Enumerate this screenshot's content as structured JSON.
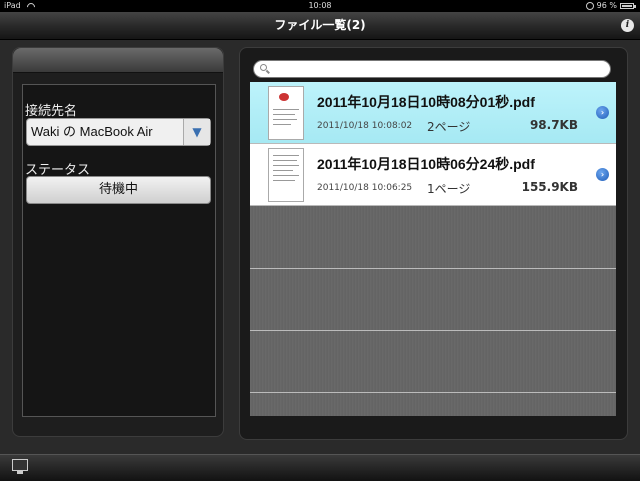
{
  "status_bar": {
    "device": "iPad",
    "time": "10:08",
    "battery": "96 %",
    "battery_level": 0.96
  },
  "nav": {
    "title": "ファイル一覧(2)",
    "info_symbol": "i"
  },
  "left": {
    "dest_label": "接続先名",
    "dest_value": "Waki の MacBook Air",
    "dest_arrow": "▼",
    "status_label": "ステータス",
    "status_value": "待機中"
  },
  "search": {
    "placeholder": ""
  },
  "files": [
    {
      "name": "2011年10月18日10時08分01秒.pdf",
      "date": "2011/10/18 10:08:02",
      "pages": "2ページ",
      "size": "98.7KB",
      "selected": true
    },
    {
      "name": "2011年10月18日10時06分24秒.pdf",
      "date": "2011/10/18 10:06:25",
      "pages": "1ページ",
      "size": "155.9KB",
      "selected": false
    }
  ],
  "icons": [
    "wifi-icon",
    "lock-icon",
    "battery-icon",
    "info-icon",
    "search-icon",
    "disclosure-icon",
    "monitor-icon"
  ],
  "colors": {
    "selected_row": "#bdf3fb",
    "disclosure": "#1f5db8"
  }
}
